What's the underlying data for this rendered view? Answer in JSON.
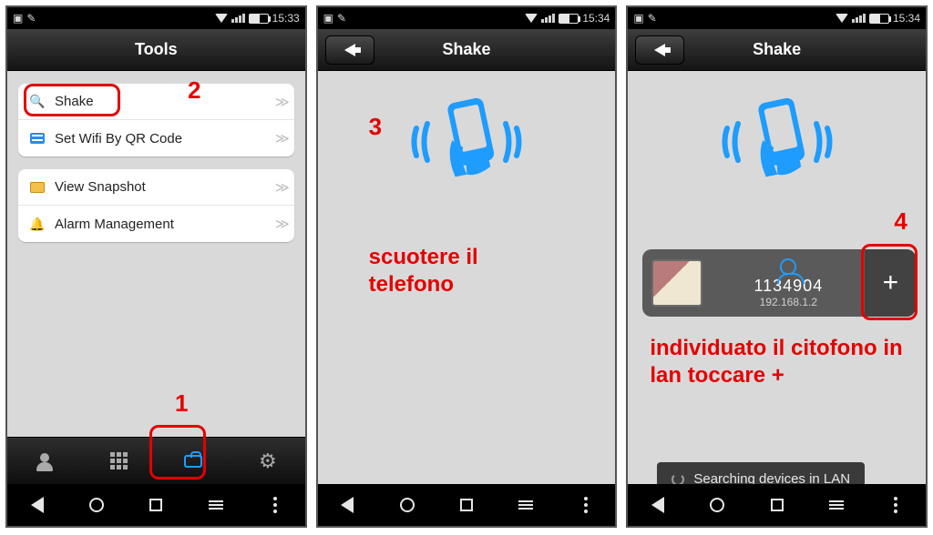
{
  "status": {
    "time_a": "15:33",
    "time_b": "15:34",
    "time_c": "15:34"
  },
  "screen1": {
    "title": "Tools",
    "rows": {
      "shake": "Shake",
      "qr": "Set Wifi By QR Code",
      "snap": "View Snapshot",
      "alarm": "Alarm Management"
    },
    "callouts": {
      "num1": "1",
      "num2": "2"
    }
  },
  "screen2": {
    "title": "Shake",
    "callouts": {
      "num3": "3",
      "text": "scuotere il\ntelefono"
    }
  },
  "screen3": {
    "title": "Shake",
    "device": {
      "id": "1134904",
      "ip": "192.168.1.2"
    },
    "toast": "Searching devices in LAN",
    "callouts": {
      "num4": "4",
      "text": "individuato il citofono in lan toccare  +"
    }
  }
}
